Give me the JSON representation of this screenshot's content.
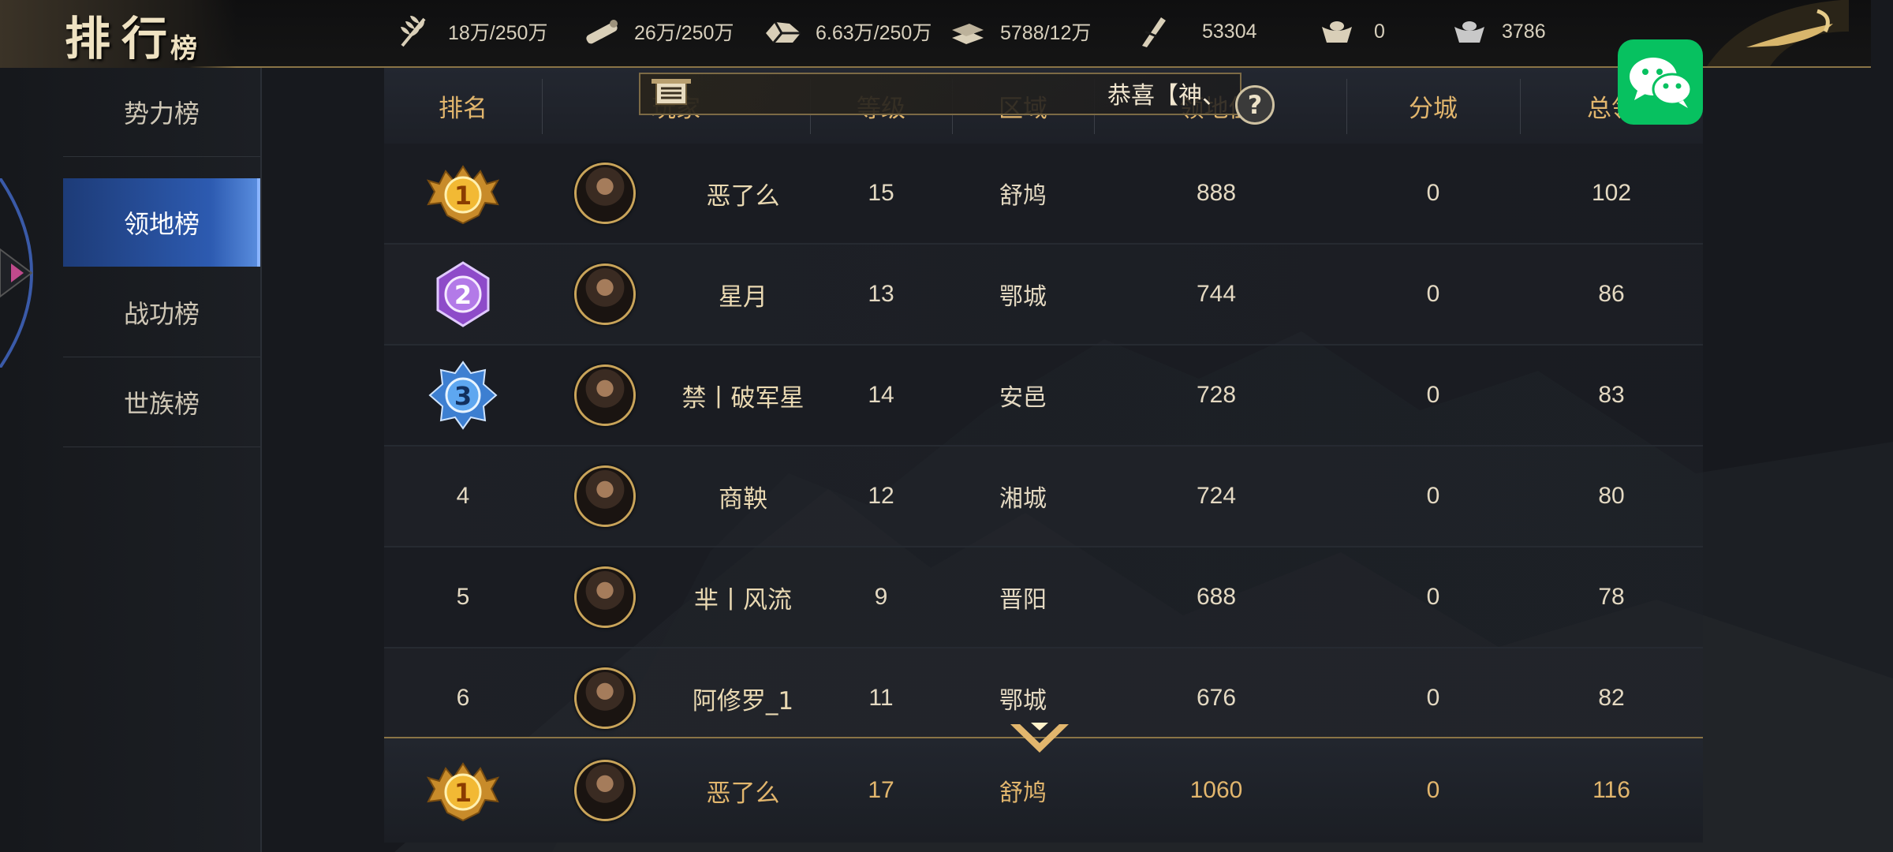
{
  "header": {
    "title_main": "排行",
    "title_sub": "榜",
    "resources": [
      {
        "icon": "grain-icon",
        "value": "18万/250万"
      },
      {
        "icon": "wood-icon",
        "value": "26万/250万"
      },
      {
        "icon": "stone-icon",
        "value": "6.63万/250万"
      },
      {
        "icon": "iron-icon",
        "value": "5788/12万"
      },
      {
        "icon": "decree-icon",
        "value": "53304"
      },
      {
        "icon": "gold-ingot-icon",
        "value": "0"
      },
      {
        "icon": "silver-ingot-icon",
        "value": "3786"
      }
    ]
  },
  "sidebar": {
    "items": [
      {
        "label": "势力榜",
        "active": false
      },
      {
        "label": "领地榜",
        "active": true
      },
      {
        "label": "战功榜",
        "active": false
      },
      {
        "label": "世族榜",
        "active": false
      }
    ]
  },
  "banner": {
    "text": "恭喜【神、"
  },
  "table": {
    "headers": [
      "排名",
      "玩家",
      "等级",
      "区域",
      "领地值",
      "分城",
      "总领"
    ],
    "rows": [
      {
        "rank": "1",
        "name": "恶了么",
        "level": "15",
        "region": "舒鸠",
        "territory": "888",
        "branch": "0",
        "total": "102"
      },
      {
        "rank": "2",
        "name": "星月",
        "level": "13",
        "region": "鄂城",
        "territory": "744",
        "branch": "0",
        "total": "86"
      },
      {
        "rank": "3",
        "name": "禁丨破军星",
        "level": "14",
        "region": "安邑",
        "territory": "728",
        "branch": "0",
        "total": "83"
      },
      {
        "rank": "4",
        "name": "商鞅",
        "level": "12",
        "region": "湘城",
        "territory": "724",
        "branch": "0",
        "total": "80"
      },
      {
        "rank": "5",
        "name": "芈丨风流",
        "level": "9",
        "region": "晋阳",
        "territory": "688",
        "branch": "0",
        "total": "78"
      },
      {
        "rank": "6",
        "name": "阿修罗_1",
        "level": "11",
        "region": "鄂城",
        "territory": "676",
        "branch": "0",
        "total": "82"
      }
    ],
    "self_row": {
      "rank": "1",
      "name": "恶了么",
      "level": "17",
      "region": "舒鸠",
      "territory": "1060",
      "branch": "0",
      "total": "116"
    }
  },
  "help": {
    "label": "?"
  },
  "colors": {
    "gold": "#e2b66d",
    "active_tab": "#2d5bb1",
    "wechat": "#07c160"
  }
}
